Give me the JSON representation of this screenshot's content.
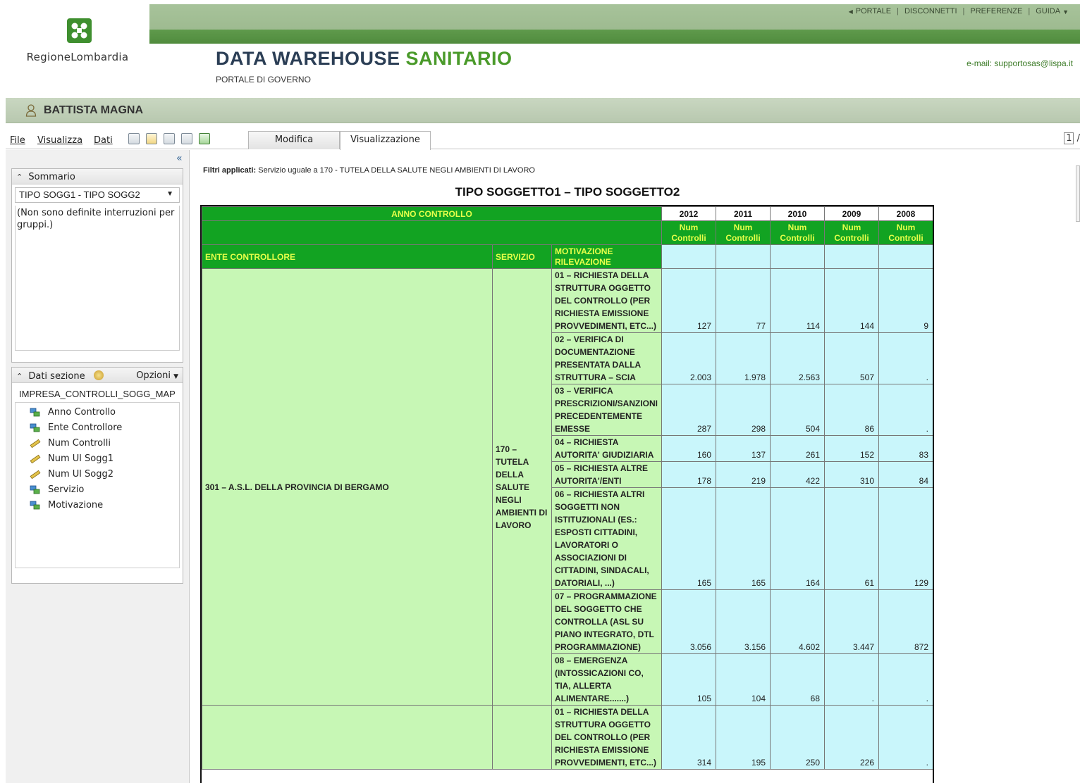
{
  "header": {
    "links": [
      "PORTALE",
      "DISCONNETTI",
      "PREFERENZE",
      "GUIDA"
    ],
    "logo_text": "RegioneLombardia",
    "title_main": "DATA WAREHOUSE",
    "title_accent": "SANITARIO",
    "subtitle": "PORTALE DI GOVERNO",
    "email": "e-mail: supportosas@lispa.it"
  },
  "user": {
    "name": "BATTISTA MAGNA"
  },
  "toolbar": {
    "menus": [
      "File",
      "Visualizza",
      "Dati"
    ],
    "tabs": [
      "Modifica",
      "Visualizzazione"
    ],
    "active_tab": "Visualizzazione",
    "page_num": "1",
    "page_sep": "/"
  },
  "sidebar": {
    "collapse_label": "«",
    "sommario": {
      "title": "Sommario",
      "selected": "TIPO SOGG1 - TIPO SOGG2",
      "message": "(Non sono definite interruzioni per gruppi.)"
    },
    "dati_sezione": {
      "title": "Dati sezione",
      "options_label": "Opzioni",
      "dataset": "IMPRESA_CONTROLLI_SOGG_MAP",
      "fields": [
        {
          "label": "Anno Controllo",
          "icon": "dimension-icon"
        },
        {
          "label": "Ente Controllore",
          "icon": "dimension-icon"
        },
        {
          "label": "Num Controlli",
          "icon": "measure-icon"
        },
        {
          "label": "Num Ul Sogg1",
          "icon": "measure-icon"
        },
        {
          "label": "Num Ul Sogg2",
          "icon": "measure-icon"
        },
        {
          "label": "Servizio",
          "icon": "dimension-icon"
        },
        {
          "label": "Motivazione",
          "icon": "dimension-icon"
        }
      ]
    }
  },
  "report": {
    "filters_label": "Filtri applicati:",
    "filters_text": " Servizio uguale a 170 - TUTELA DELLA SALUTE NEGLI AMBIENTI DI LAVORO",
    "title": "TIPO SOGGETTO1 – TIPO SOGGETTO2",
    "col_anno": "ANNO CONTROLLO",
    "years": [
      "2012",
      "2011",
      "2010",
      "2009",
      "2008"
    ],
    "measure_line1": "Num",
    "measure_line2": "Controlli",
    "col_ente": "ENTE CONTROLLORE",
    "col_servizio": "SERVIZIO",
    "col_motivazione": "MOTIVAZIONE RILEVAZIONE",
    "ente": "301 – A.S.L. DELLA PROVINCIA DI BERGAMO",
    "servizio": "170 – TUTELA DELLA SALUTE NEGLI AMBIENTI DI LAVORO",
    "rows": [
      {
        "motivazione": "01 – RICHIESTA DELLA STRUTTURA OGGETTO DEL CONTROLLO (PER RICHIESTA EMISSIONE PROVVEDIMENTI, ETC...)",
        "values": [
          "127",
          "77",
          "114",
          "144",
          "9"
        ]
      },
      {
        "motivazione": "02 – VERIFICA DI DOCUMENTAZIONE PRESENTATA DALLA STRUTTURA – SCIA",
        "values": [
          "2.003",
          "1.978",
          "2.563",
          "507",
          "."
        ]
      },
      {
        "motivazione": "03 – VERIFICA PRESCRIZIONI/SANZIONI PRECEDENTEMENTE EMESSE",
        "values": [
          "287",
          "298",
          "504",
          "86",
          "."
        ]
      },
      {
        "motivazione": "04 – RICHIESTA AUTORITA' GIUDIZIARIA",
        "values": [
          "160",
          "137",
          "261",
          "152",
          "83"
        ]
      },
      {
        "motivazione": "05 – RICHIESTA ALTRE AUTORITA'/ENTI",
        "values": [
          "178",
          "219",
          "422",
          "310",
          "84"
        ]
      },
      {
        "motivazione": "06 – RICHIESTA ALTRI SOGGETTI NON ISTITUZIONALI (ES.: ESPOSTI CITTADINI, LAVORATORI O ASSOCIAZIONI DI CITTADINI, SINDACALI, DATORIALI, ...)",
        "values": [
          "165",
          "165",
          "164",
          "61",
          "129"
        ]
      },
      {
        "motivazione": "07 – PROGRAMMAZIONE DEL SOGGETTO CHE CONTROLLA (ASL SU PIANO INTEGRATO, DTL PROGRAMMAZIONE)",
        "values": [
          "3.056",
          "3.156",
          "4.602",
          "3.447",
          "872"
        ]
      },
      {
        "motivazione": "08 – EMERGENZA (INTOSSICAZIONI CO, TIA, ALLERTA ALIMENTARE.......)",
        "values": [
          "105",
          "104",
          "68",
          ".",
          "."
        ]
      }
    ],
    "next_row": {
      "motivazione": "01 – RICHIESTA DELLA STRUTTURA OGGETTO DEL CONTROLLO (PER RICHIESTA EMISSIONE PROVVEDIMENTI, ETC...)",
      "values": [
        "314",
        "195",
        "250",
        "226",
        "."
      ]
    }
  }
}
